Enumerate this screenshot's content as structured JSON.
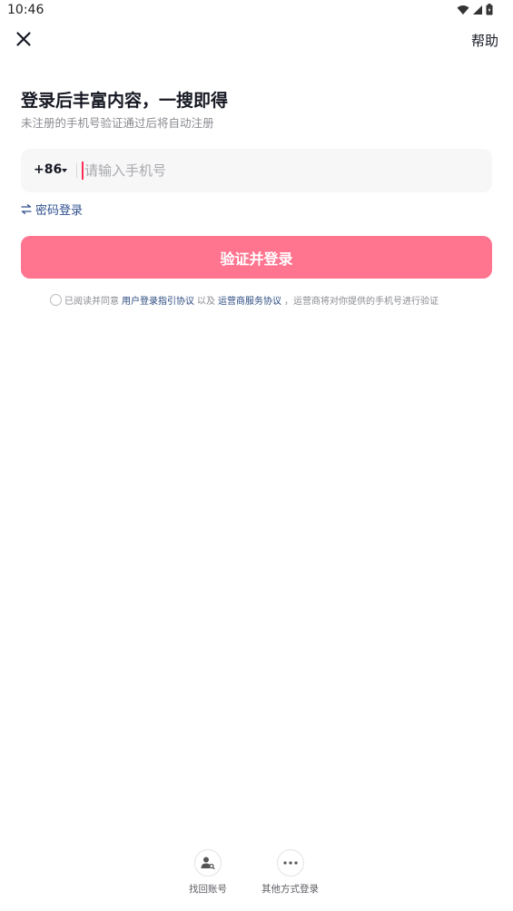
{
  "status_bar": {
    "time": "10:46"
  },
  "header": {
    "help_label": "帮助"
  },
  "content": {
    "title": "登录后丰富内容，一搜即得",
    "subtitle": "未注册的手机号验证通过后将自动注册"
  },
  "phone_form": {
    "country_code": "+86",
    "phone_value": "",
    "phone_placeholder": "请输入手机号"
  },
  "password_login_label": "密码登录",
  "submit_label": "验证并登录",
  "agreement": {
    "prefix": "已阅读并同意",
    "link1": "用户登录指引协议",
    "joiner": "以及",
    "link2": "运营商服务协议",
    "suffix": "，运营商将对你提供的手机号进行验证"
  },
  "bottom_actions": {
    "find_account_label": "找回账号",
    "other_login_label": "其他方式登录"
  },
  "colors": {
    "accent": "#fe2c55",
    "button_bg": "#ff748f",
    "link": "#2a4a7f"
  }
}
